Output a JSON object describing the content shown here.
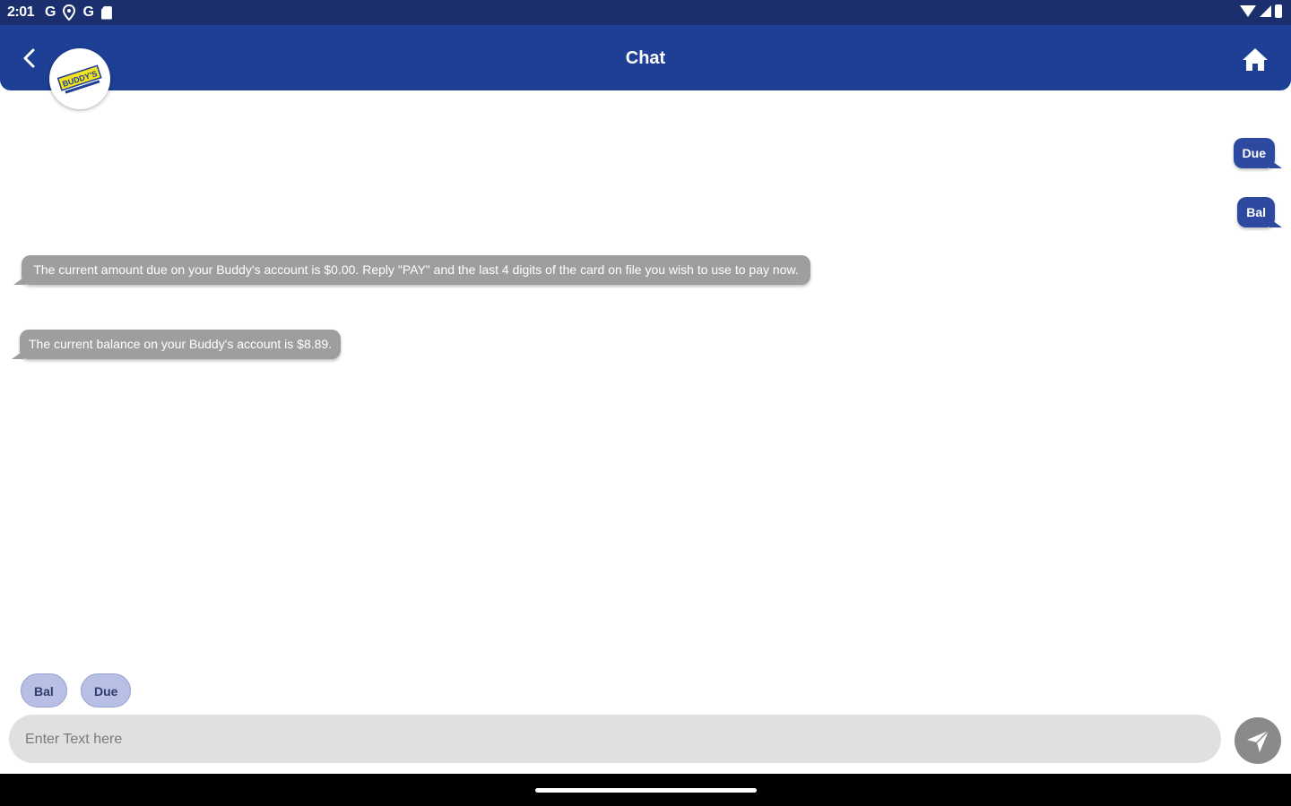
{
  "status_bar": {
    "time": "2:01",
    "icons": [
      "google-icon",
      "location-icon",
      "google-icon",
      "sd-card-icon",
      "wifi-icon",
      "signal-icon",
      "battery-icon"
    ]
  },
  "header": {
    "title": "Chat",
    "back_icon": "chevron-left-icon",
    "home_icon": "home-icon",
    "background": "#1e3f96"
  },
  "avatar": {
    "logo_text": "BUDDY'S"
  },
  "messages": [
    {
      "direction": "out",
      "text": "Due"
    },
    {
      "direction": "out",
      "text": "Bal"
    },
    {
      "direction": "in",
      "text": "The current amount due on your Buddy's account is $0.00. Reply \"PAY\" and the last 4 digits of the card on file you wish to use to pay now."
    },
    {
      "direction": "in",
      "text": "The current balance on your Buddy's account is $8.89."
    }
  ],
  "quick_replies": [
    "Bal",
    "Due"
  ],
  "composer": {
    "placeholder": "Enter Text here",
    "value": "",
    "send_icon": "send-icon"
  },
  "colors": {
    "outgoing_bubble": "#2d4aa0",
    "incoming_bubble": "#9e9e9e",
    "chip": "#b7c0e4"
  }
}
